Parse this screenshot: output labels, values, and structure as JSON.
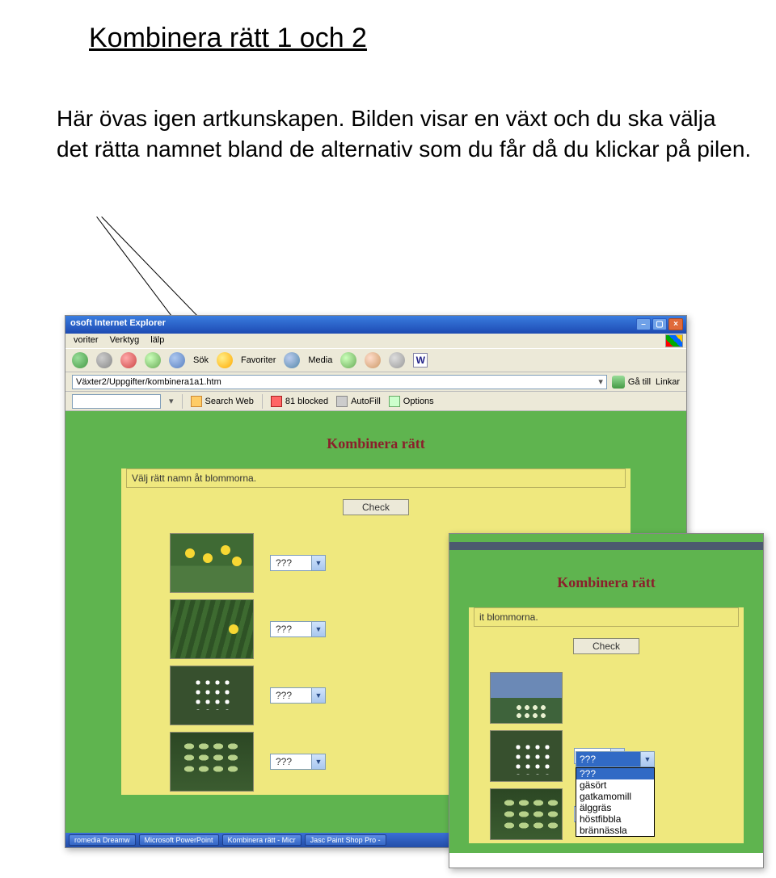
{
  "doc": {
    "title": "Kombinera rätt 1 och 2",
    "para": "Här övas igen artkunskapen. Bilden visar en växt och du ska välja det rätta namnet bland  de alternativ som du får då du klickar på pilen."
  },
  "shotA": {
    "titlebar": "osoft Internet Explorer",
    "menu": {
      "m1": "voriter",
      "m2": "Verktyg",
      "m3": "lälp"
    },
    "toolbar": {
      "sok": "Sök",
      "favoriter": "Favoriter",
      "media": "Media",
      "wmark": "W"
    },
    "addr": {
      "url": "Växter2/Uppgifter/kombinera1a1.htm",
      "go": "Gå till",
      "linkar": "Linkar"
    },
    "gbar": {
      "search": "Search Web",
      "blocked": "81 blocked",
      "autofill": "AutoFill",
      "options": "Options"
    },
    "content_title": "Kombinera rätt",
    "instruction": "Välj rätt namn åt blommorna.",
    "check": "Check",
    "placeholder": "???",
    "taskbar": {
      "t1": "romedia Dreamw",
      "t2": "Microsoft PowerPoint",
      "t3": "Kombinera rätt - Micr",
      "t4": "Jasc Paint Shop Pro -"
    }
  },
  "shotB": {
    "content_title": "Kombinera rätt",
    "instruction": "it blommorna.",
    "check": "Check",
    "placeholder": "???",
    "dropdown": {
      "selected": "???",
      "opt0": "???",
      "opt1": "gäsört",
      "opt2": "gatkamomill",
      "opt3": "älggräs",
      "opt4": "höstfibbla",
      "opt5": "brännässla"
    }
  }
}
